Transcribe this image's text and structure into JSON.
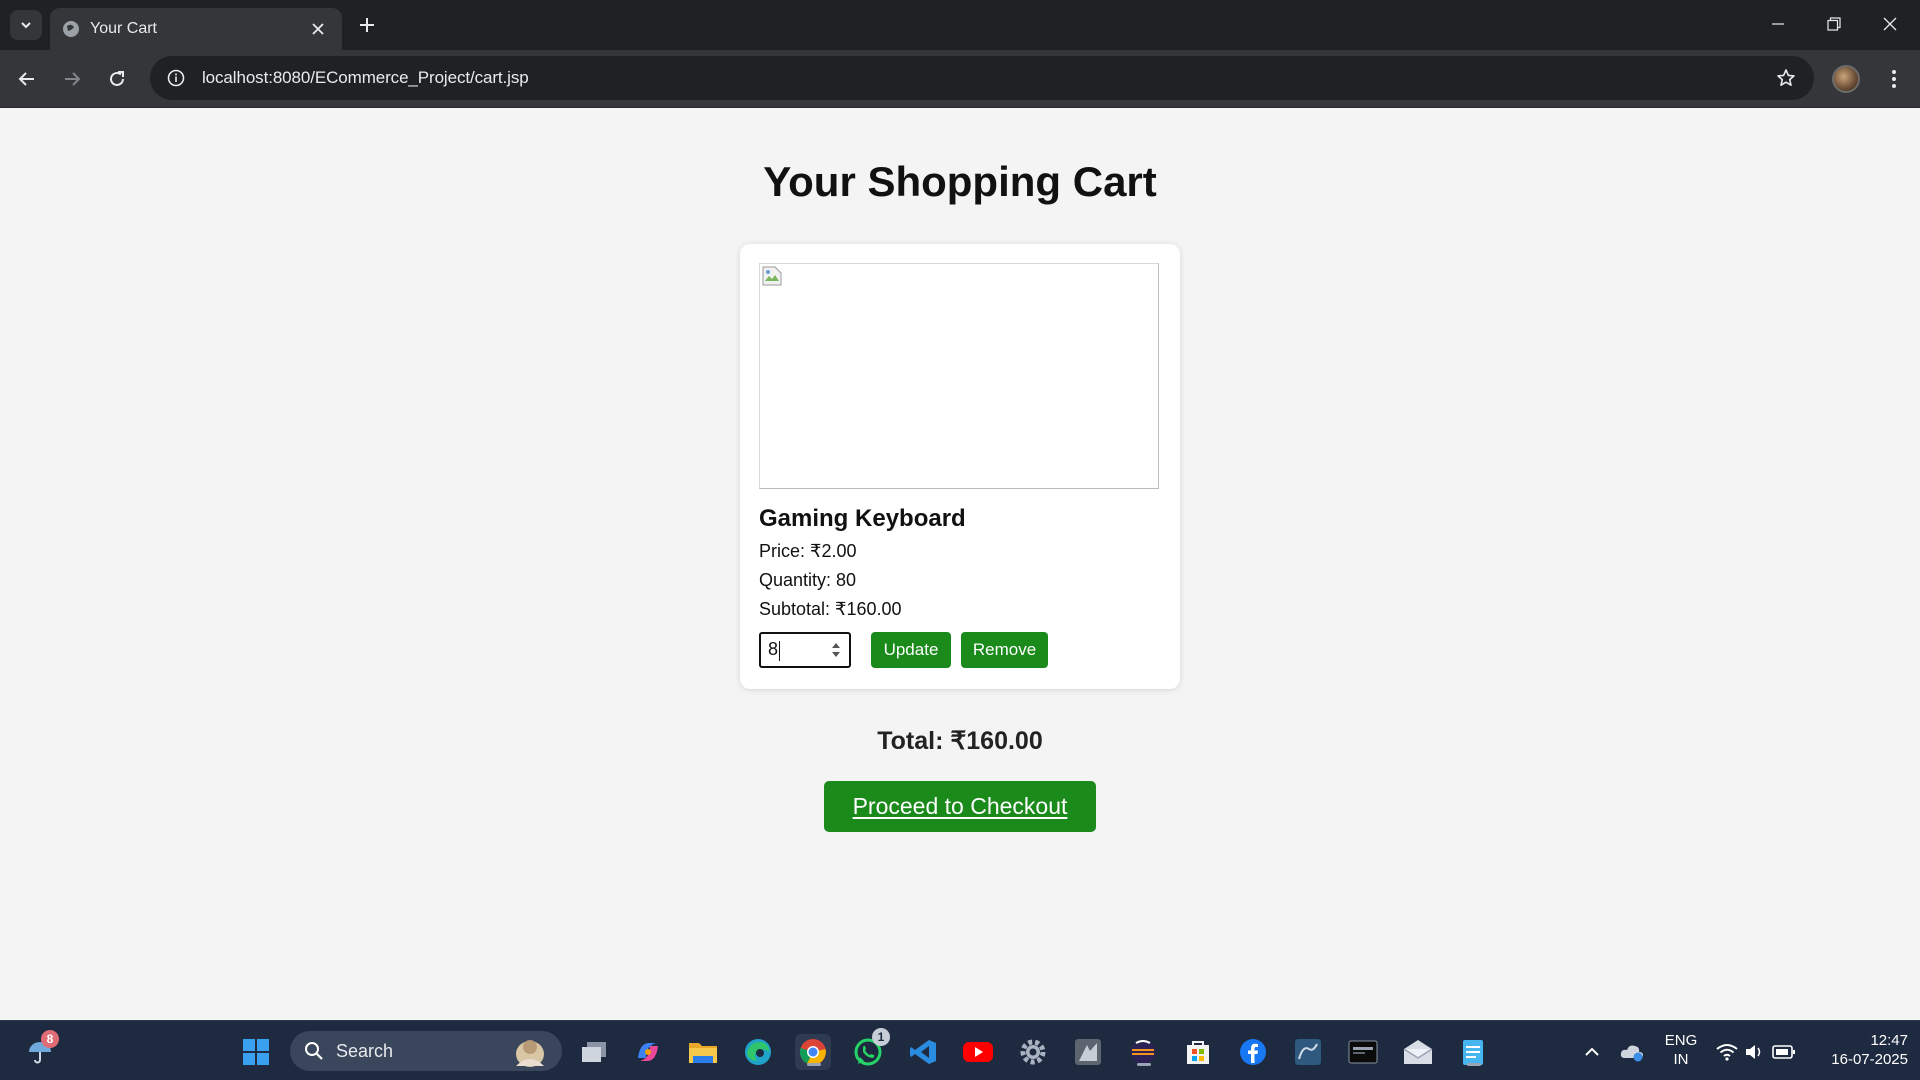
{
  "browser": {
    "tab_title": "Your Cart",
    "url": "localhost:8080/ECommerce_Project/cart.jsp"
  },
  "page": {
    "title": "Your Shopping Cart",
    "cart_item": {
      "name": "Gaming Keyboard",
      "price": "Price: ₹2.00",
      "quantity": "Quantity: 80",
      "subtotal": "Subtotal: ₹160.00",
      "qty_input_value": "8",
      "update_label": "Update",
      "remove_label": "Remove"
    },
    "total": "Total: ₹160.00",
    "checkout_label": "Proceed to Checkout"
  },
  "taskbar": {
    "weather_badge": "8",
    "search_label": "Search",
    "whatsapp_badge": "1",
    "lang_line1": "ENG",
    "lang_line2": "IN",
    "time": "12:47",
    "date": "16-07-2025"
  },
  "colors": {
    "accent_green": "#1a8a1a",
    "chrome_dark": "#202124",
    "chrome_toolbar": "#35363a",
    "taskbar": "#1e2a3f"
  }
}
